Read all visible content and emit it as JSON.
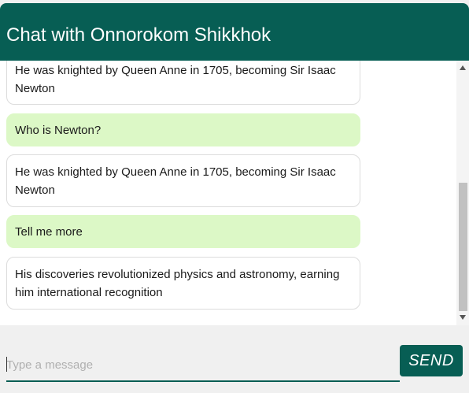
{
  "header": {
    "title": "Chat with Onnorokom Shikkhok"
  },
  "messages": [
    {
      "sender": "bot",
      "text": "He was knighted by Queen Anne in 1705, becoming Sir Isaac Newton"
    },
    {
      "sender": "user",
      "text": "Who is Newton?"
    },
    {
      "sender": "bot",
      "text": "He was knighted by Queen Anne in 1705, becoming Sir Isaac Newton"
    },
    {
      "sender": "user",
      "text": "Tell me more"
    },
    {
      "sender": "bot",
      "text": "His discoveries revolutionized physics and astronomy, earning him international recognition"
    }
  ],
  "composer": {
    "placeholder": "Type a message",
    "value": ""
  },
  "send_button": {
    "label": "SEND"
  },
  "colors": {
    "accent": "#075e54",
    "user_bubble": "#dcf8c6",
    "bot_bubble": "#ffffff"
  }
}
